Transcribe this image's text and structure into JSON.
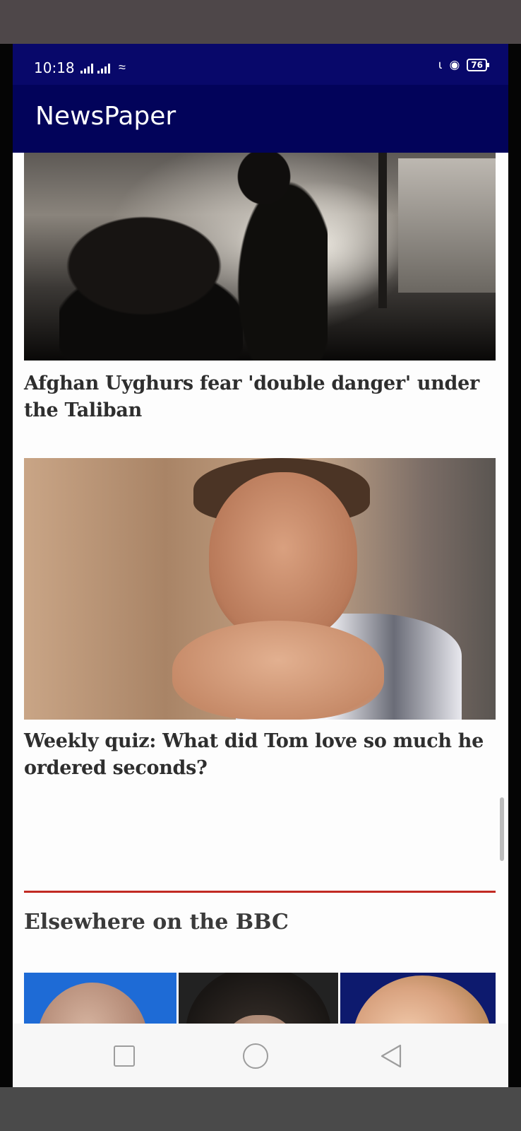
{
  "status_bar": {
    "time": "10:18",
    "battery": "76",
    "icons": [
      "cellular-signal-icon",
      "cellular-signal-icon",
      "wifi-icon",
      "mute-icon",
      "data-saver-icon",
      "battery-icon"
    ]
  },
  "app_bar": {
    "title": "NewsPaper",
    "color": "#02035a"
  },
  "articles": [
    {
      "headline": "Afghan Uyghurs fear 'double danger' under the Taliban"
    },
    {
      "headline": "Weekly quiz: What did Tom love so much he ordered seconds?"
    }
  ],
  "section": {
    "title": "Elsewhere on the BBC",
    "rule_color": "#c22a23",
    "thumbnails": [
      "thumbnail-1",
      "thumbnail-2",
      "thumbnail-3"
    ]
  },
  "nav_bar": {
    "buttons": [
      "recent-apps-icon",
      "home-icon",
      "back-icon"
    ]
  }
}
